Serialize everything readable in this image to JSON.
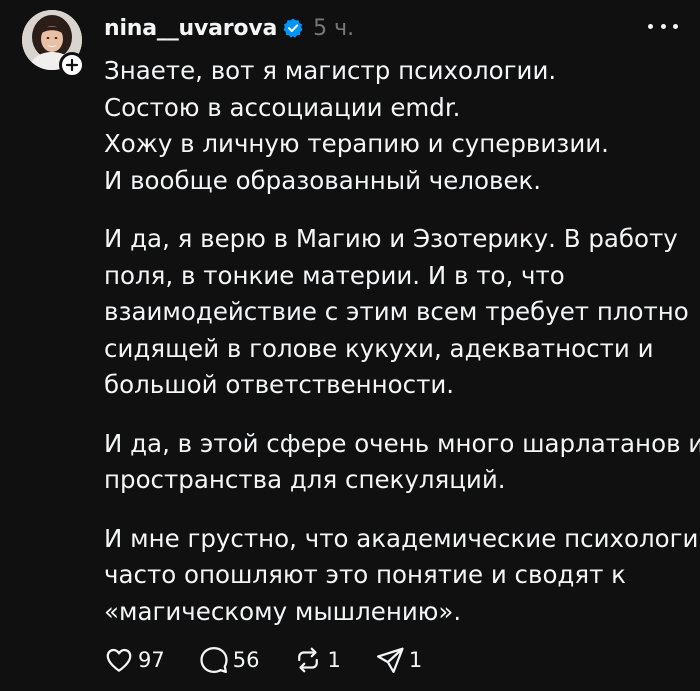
{
  "post": {
    "username": "nina__uvarova",
    "timestamp": "5 ч.",
    "paragraphs": [
      [
        "Знаете, вот я магистр психологии.",
        "Состою в ассоциации emdr.",
        "Хожу в личную терапию и супервизии.",
        "И вообще образованный человек."
      ],
      [
        "И да, я верю в Магию и Эзотерику. В работу",
        "поля, в тонкие материи. И в то, что",
        "взаимодействие с этим всем требует плотно",
        "сидящей в голове кукухи, адекватности и",
        "большой ответственности."
      ],
      [
        "И да, в этой сфере очень много шарлатанов и",
        "пространства для спекуляций."
      ],
      [
        "И мне грустно, что академические психологи",
        "часто опошляют это понятие и сводят к",
        "«магическому мышлению»."
      ]
    ],
    "counts": {
      "likes": "97",
      "replies": "56",
      "reposts": "1",
      "shares": "1"
    }
  },
  "icons": {
    "avatar": "avatar",
    "follow": "plus-icon",
    "verified": "verified-badge-icon",
    "more": "more-horizontal-icon",
    "like": "heart-icon",
    "reply": "comment-icon",
    "repost": "repost-icon",
    "share": "send-icon"
  },
  "colors": {
    "background": "#101010",
    "text": "#f3f5f7",
    "muted": "#777777",
    "verified": "#0095f6"
  }
}
